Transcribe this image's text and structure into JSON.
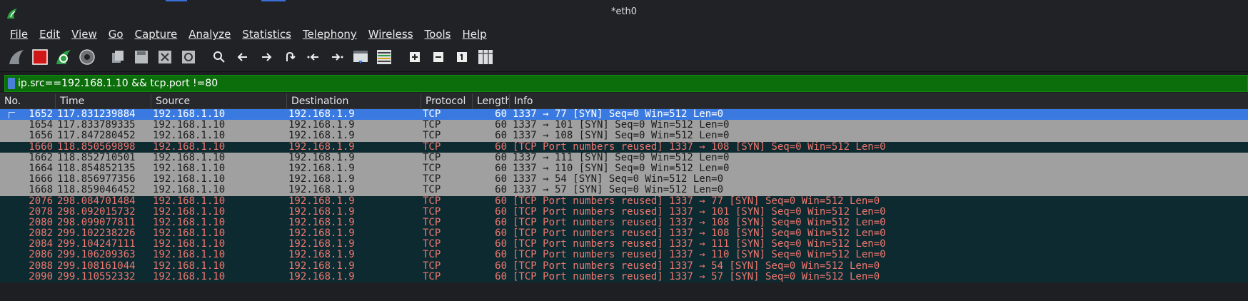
{
  "window": {
    "title": "*eth0"
  },
  "menu": [
    "File",
    "Edit",
    "View",
    "Go",
    "Capture",
    "Analyze",
    "Statistics",
    "Telephony",
    "Wireless",
    "Tools",
    "Help"
  ],
  "toolbar": {
    "icons": [
      "shark-fin-start-icon",
      "stop-capture-icon",
      "restart-capture-icon",
      "capture-options-icon",
      "open-file-icon",
      "save-file-icon",
      "close-file-icon",
      "reload-file-icon",
      "search-icon",
      "go-back-icon",
      "go-forward-icon",
      "go-to-packet-icon",
      "go-first-icon",
      "go-last-icon",
      "autoscroll-icon",
      "colorize-icon",
      "zoom-in-icon",
      "zoom-out-icon",
      "normal-size-icon",
      "resize-columns-icon"
    ]
  },
  "filter": {
    "value": "ip.src==192.168.1.10 && tcp.port !=80"
  },
  "columns": [
    "No.",
    "Time",
    "Source",
    "Destination",
    "Protocol",
    "Length",
    "Info"
  ],
  "colors": {
    "selected": "#3a7ae0",
    "normal_row": "#a0a0a0",
    "reused_row_bg": "#0d2a30",
    "reused_row_fg": "#f0776f",
    "filter_ok": "#0b6e0b"
  },
  "packets": [
    {
      "no": "1652",
      "time": "117.831239884",
      "src": "192.168.1.10",
      "dst": "192.168.1.9",
      "proto": "TCP",
      "len": "60",
      "info": "1337 → 77 [SYN] Seq=0 Win=512 Len=0",
      "style": "selected"
    },
    {
      "no": "1654",
      "time": "117.833789335",
      "src": "192.168.1.10",
      "dst": "192.168.1.9",
      "proto": "TCP",
      "len": "60",
      "info": "1337 → 101 [SYN] Seq=0 Win=512 Len=0",
      "style": "normal"
    },
    {
      "no": "1656",
      "time": "117.847280452",
      "src": "192.168.1.10",
      "dst": "192.168.1.9",
      "proto": "TCP",
      "len": "60",
      "info": "1337 → 108 [SYN] Seq=0 Win=512 Len=0",
      "style": "normal"
    },
    {
      "no": "1660",
      "time": "118.850569898",
      "src": "192.168.1.10",
      "dst": "192.168.1.9",
      "proto": "TCP",
      "len": "60",
      "info": "[TCP Port numbers reused] 1337 → 108 [SYN] Seq=0 Win=512 Len=0",
      "style": "reused"
    },
    {
      "no": "1662",
      "time": "118.852710501",
      "src": "192.168.1.10",
      "dst": "192.168.1.9",
      "proto": "TCP",
      "len": "60",
      "info": "1337 → 111 [SYN] Seq=0 Win=512 Len=0",
      "style": "normal"
    },
    {
      "no": "1664",
      "time": "118.854852135",
      "src": "192.168.1.10",
      "dst": "192.168.1.9",
      "proto": "TCP",
      "len": "60",
      "info": "1337 → 110 [SYN] Seq=0 Win=512 Len=0",
      "style": "normal"
    },
    {
      "no": "1666",
      "time": "118.856977356",
      "src": "192.168.1.10",
      "dst": "192.168.1.9",
      "proto": "TCP",
      "len": "60",
      "info": "1337 → 54 [SYN] Seq=0 Win=512 Len=0",
      "style": "normal"
    },
    {
      "no": "1668",
      "time": "118.859046452",
      "src": "192.168.1.10",
      "dst": "192.168.1.9",
      "proto": "TCP",
      "len": "60",
      "info": "1337 → 57 [SYN] Seq=0 Win=512 Len=0",
      "style": "normal"
    },
    {
      "no": "2076",
      "time": "298.084701484",
      "src": "192.168.1.10",
      "dst": "192.168.1.9",
      "proto": "TCP",
      "len": "60",
      "info": "[TCP Port numbers reused] 1337 → 77 [SYN] Seq=0 Win=512 Len=0",
      "style": "reused"
    },
    {
      "no": "2078",
      "time": "298.092015732",
      "src": "192.168.1.10",
      "dst": "192.168.1.9",
      "proto": "TCP",
      "len": "60",
      "info": "[TCP Port numbers reused] 1337 → 101 [SYN] Seq=0 Win=512 Len=0",
      "style": "reused"
    },
    {
      "no": "2080",
      "time": "298.099077811",
      "src": "192.168.1.10",
      "dst": "192.168.1.9",
      "proto": "TCP",
      "len": "60",
      "info": "[TCP Port numbers reused] 1337 → 108 [SYN] Seq=0 Win=512 Len=0",
      "style": "reused"
    },
    {
      "no": "2082",
      "time": "299.102238226",
      "src": "192.168.1.10",
      "dst": "192.168.1.9",
      "proto": "TCP",
      "len": "60",
      "info": "[TCP Port numbers reused] 1337 → 108 [SYN] Seq=0 Win=512 Len=0",
      "style": "reused"
    },
    {
      "no": "2084",
      "time": "299.104247111",
      "src": "192.168.1.10",
      "dst": "192.168.1.9",
      "proto": "TCP",
      "len": "60",
      "info": "[TCP Port numbers reused] 1337 → 111 [SYN] Seq=0 Win=512 Len=0",
      "style": "reused"
    },
    {
      "no": "2086",
      "time": "299.106209363",
      "src": "192.168.1.10",
      "dst": "192.168.1.9",
      "proto": "TCP",
      "len": "60",
      "info": "[TCP Port numbers reused] 1337 → 110 [SYN] Seq=0 Win=512 Len=0",
      "style": "reused"
    },
    {
      "no": "2088",
      "time": "299.108161044",
      "src": "192.168.1.10",
      "dst": "192.168.1.9",
      "proto": "TCP",
      "len": "60",
      "info": "[TCP Port numbers reused] 1337 → 54 [SYN] Seq=0 Win=512 Len=0",
      "style": "reused"
    },
    {
      "no": "2090",
      "time": "299.110552332",
      "src": "192.168.1.10",
      "dst": "192.168.1.9",
      "proto": "TCP",
      "len": "60",
      "info": "[TCP Port numbers reused] 1337 → 57 [SYN] Seq=0 Win=512 Len=0",
      "style": "reused"
    }
  ]
}
